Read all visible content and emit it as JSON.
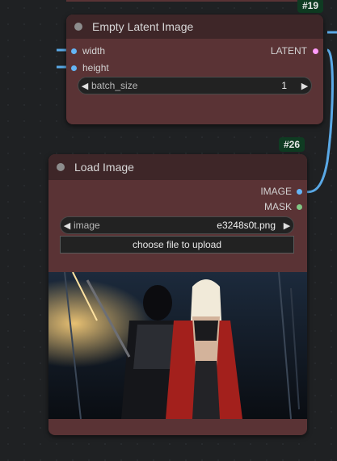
{
  "nodes": {
    "empty_latent": {
      "id_badge": "#19",
      "title": "Empty Latent Image",
      "inputs": [
        "width",
        "height"
      ],
      "output": "LATENT",
      "widget": {
        "label": "batch_size",
        "value": "1"
      }
    },
    "load_image": {
      "id_badge": "#26",
      "title": "Load Image",
      "outputs": [
        "IMAGE",
        "MASK"
      ],
      "widget": {
        "label": "image",
        "value": "e3248s0t.png"
      },
      "upload_label": "choose file to upload"
    }
  },
  "colors": {
    "node_body": "#5a3335",
    "node_header": "#3e2628",
    "latent_slot": "#ff9cf9",
    "image_slot": "#64b5f6",
    "mask_slot": "#81c784",
    "wire": "#5aa9e6"
  }
}
